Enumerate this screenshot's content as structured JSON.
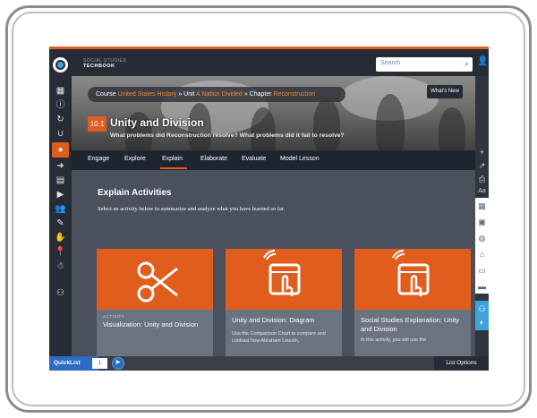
{
  "brand": {
    "line1": "SOCIAL STUDIES",
    "line2": "TECHBOOK"
  },
  "search": {
    "placeholder": "Search"
  },
  "breadcrumb": {
    "course_label": "Course",
    "course_value": "United States History",
    "unit_label": "Unit",
    "unit_value": "A Nation Divided",
    "chapter_label": "Chapter",
    "chapter_value": "Reconstruction"
  },
  "whats_new": "What's New",
  "lesson": {
    "number": "10.1",
    "title": "Unity and Division",
    "subtitle": "What problems did Reconstruction resolve? What problems did it fail to resolve?"
  },
  "tabs": [
    {
      "label": "Engage"
    },
    {
      "label": "Explore"
    },
    {
      "label": "Explain"
    },
    {
      "label": "Elaborate"
    },
    {
      "label": "Evaluate"
    },
    {
      "label": "Model Lesson"
    }
  ],
  "section": {
    "title": "Explain Activities",
    "description": "Select an activity below to summarize and analyze what you have learned so far."
  },
  "cards": [
    {
      "kicker": "ACTIVITY",
      "title": "Visualization: Unity and Division",
      "text": ""
    },
    {
      "kicker": "",
      "title": "Unity and Division: Diagram",
      "text": "Use the Comparison Chart to compare and contrast how Abraham Lincoln,"
    },
    {
      "kicker": "",
      "title": "Social Studies Explanation: Unity and Division",
      "text": "In this activity, you will use the"
    }
  ],
  "bottom": {
    "quicklist": "QuickList",
    "count": "1",
    "list_options": "List Options"
  },
  "colors": {
    "accent": "#e05d1e",
    "blue": "#2b6cc4",
    "dark": "#262b35"
  }
}
